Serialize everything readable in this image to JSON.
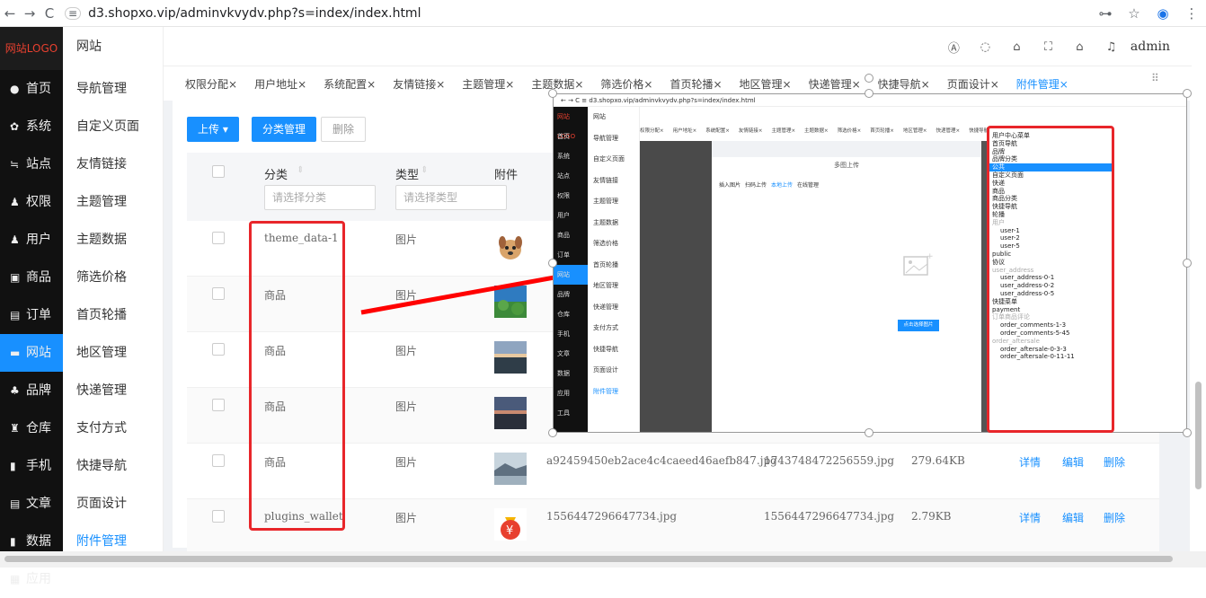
{
  "browser": {
    "url": "d3.shopxo.vip/adminvkvydv.php?s=index/index.html",
    "back": "←",
    "forward": "→",
    "reload": "C"
  },
  "sidebar": {
    "logo": "网站LOGO",
    "items": [
      {
        "icon": "home-icon",
        "glyph": "●",
        "label": "首页"
      },
      {
        "icon": "gear-icon",
        "glyph": "✿",
        "label": "系统"
      },
      {
        "icon": "site-icon",
        "glyph": "≒",
        "label": "站点"
      },
      {
        "icon": "permission-icon",
        "glyph": "♟",
        "label": "权限"
      },
      {
        "icon": "user-icon",
        "glyph": "♟",
        "label": "用户"
      },
      {
        "icon": "goods-icon",
        "glyph": "▣",
        "label": "商品"
      },
      {
        "icon": "order-icon",
        "glyph": "▤",
        "label": "订单"
      },
      {
        "icon": "web-icon",
        "glyph": "▬",
        "label": "网站",
        "active": true
      },
      {
        "icon": "brand-icon",
        "glyph": "♣",
        "label": "品牌"
      },
      {
        "icon": "warehouse-icon",
        "glyph": "♜",
        "label": "仓库"
      },
      {
        "icon": "mobile-icon",
        "glyph": "▮",
        "label": "手机"
      },
      {
        "icon": "article-icon",
        "glyph": "▤",
        "label": "文章"
      },
      {
        "icon": "data-icon",
        "glyph": "▮",
        "label": "数据"
      },
      {
        "icon": "app-icon",
        "glyph": "▦",
        "label": "应用"
      }
    ]
  },
  "submenu": {
    "title": "网站",
    "items": [
      "导航管理",
      "自定义页面",
      "友情链接",
      "主题管理",
      "主题数据",
      "筛选价格",
      "首页轮播",
      "地区管理",
      "快递管理",
      "支付方式",
      "快捷导航",
      "页面设计",
      "附件管理"
    ],
    "active_index": 12
  },
  "topbar": {
    "user": "admin"
  },
  "tabs": [
    "权限分配×",
    "用户地址×",
    "系统配置×",
    "友情链接×",
    "主题管理×",
    "主题数据×",
    "筛选价格×",
    "首页轮播×",
    "地区管理×",
    "快递管理×",
    "快捷导航×",
    "页面设计×",
    "附件管理×"
  ],
  "toolbar": {
    "upload": "上传 ▾",
    "category": "分类管理",
    "delete": "删除"
  },
  "table": {
    "headers": {
      "category": "分类",
      "type": "类型",
      "attachment": "附件"
    },
    "filters": {
      "category_placeholder": "请选择分类",
      "type_placeholder": "请选择类型"
    },
    "rows": [
      {
        "category": "theme_data-1",
        "type": "图片",
        "thumb": "dog",
        "name": "",
        "original": "",
        "size": ""
      },
      {
        "category": "商品",
        "type": "图片",
        "thumb": "nature",
        "name": "",
        "original": "",
        "size": ""
      },
      {
        "category": "商品",
        "type": "图片",
        "thumb": "sunset",
        "name": "",
        "original": "",
        "size": ""
      },
      {
        "category": "商品",
        "type": "图片",
        "thumb": "dusk",
        "name": "",
        "original": "",
        "size": ""
      },
      {
        "category": "商品",
        "type": "图片",
        "thumb": "lake",
        "name": "a92459450eb2ace4c4caeed46aefb847.jpg",
        "original": "1743748472256559.jpg",
        "size": "279.64KB"
      },
      {
        "category": "plugins_wallet",
        "type": "图片",
        "thumb": "wallet",
        "name": "1556447296647734.jpg",
        "original": "1556447296647734.jpg",
        "size": "2.79KB"
      }
    ],
    "actions": {
      "detail": "详情",
      "edit": "编辑",
      "delete": "删除"
    }
  },
  "overlay": {
    "url": "d3.shopxo.vip/adminvkvydv.php?s=index/index.html",
    "side": [
      "网站LOGO",
      "首页",
      "系统",
      "站点",
      "权限",
      "用户",
      "商品",
      "订单",
      "网站",
      "品牌",
      "仓库",
      "手机",
      "文章",
      "数据",
      "应用",
      "工具"
    ],
    "sub": [
      "网站",
      "导航管理",
      "自定义页面",
      "友情链接",
      "主题管理",
      "主题数据",
      "筛选价格",
      "首页轮播",
      "地区管理",
      "快递管理",
      "支付方式",
      "快捷导航",
      "页面设计",
      "附件管理"
    ],
    "tabs": [
      "权限分配×",
      "用户地址×",
      "系统配置×",
      "友情链接×",
      "主题管理×",
      "主题数据×",
      "筛选价格×",
      "首页轮播×",
      "地区管理×",
      "快递管理×",
      "快捷导航×"
    ],
    "modal_title": "多图上传",
    "modal_tabs": [
      "插入图片",
      "扫码上传",
      "本地上传",
      "在线管理"
    ],
    "pick": "点击选择图片"
  },
  "dropdown": {
    "items": [
      {
        "t": "用户中心菜单",
        "k": "item"
      },
      {
        "t": "首页导航",
        "k": "item"
      },
      {
        "t": "品牌",
        "k": "item"
      },
      {
        "t": "品牌分类",
        "k": "item"
      },
      {
        "t": "公共",
        "k": "sel"
      },
      {
        "t": "自定义页面",
        "k": "item"
      },
      {
        "t": "快递",
        "k": "item"
      },
      {
        "t": "商品",
        "k": "item"
      },
      {
        "t": "商品分类",
        "k": "item"
      },
      {
        "t": "快捷导航",
        "k": "item"
      },
      {
        "t": "轮播",
        "k": "item"
      },
      {
        "t": "用户",
        "k": "group"
      },
      {
        "t": "user-1",
        "k": "sub"
      },
      {
        "t": "user-2",
        "k": "sub"
      },
      {
        "t": "user-5",
        "k": "sub"
      },
      {
        "t": "public",
        "k": "item"
      },
      {
        "t": "协议",
        "k": "item"
      },
      {
        "t": "user_address",
        "k": "group"
      },
      {
        "t": "user_address-0-1",
        "k": "sub"
      },
      {
        "t": "user_address-0-2",
        "k": "sub"
      },
      {
        "t": "user_address-0-5",
        "k": "sub"
      },
      {
        "t": "快捷菜单",
        "k": "item"
      },
      {
        "t": "payment",
        "k": "item"
      },
      {
        "t": "订单商品评论",
        "k": "group"
      },
      {
        "t": "order_comments-1-3",
        "k": "sub"
      },
      {
        "t": "order_comments-5-45",
        "k": "sub"
      },
      {
        "t": "order_aftersale",
        "k": "group"
      },
      {
        "t": "order_aftersale-0-3-3",
        "k": "sub"
      },
      {
        "t": "order_aftersale-0-11-11",
        "k": "sub"
      }
    ]
  },
  "colors": {
    "accent": "#1890ff",
    "annotation": "#e8262a",
    "sidebar": "#111111"
  }
}
